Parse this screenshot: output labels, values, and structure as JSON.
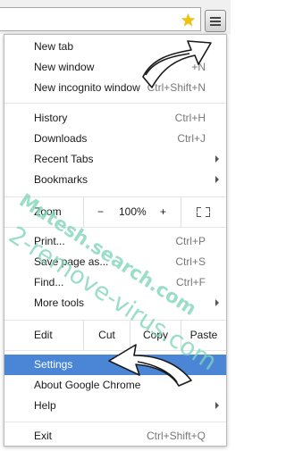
{
  "toolbar": {
    "star_icon": "bookmark-star-icon",
    "menu_icon": "hamburger-menu-icon"
  },
  "menu": {
    "group1": [
      {
        "label": "New tab",
        "shortcut": ""
      },
      {
        "label": "New window",
        "shortcut": "+N"
      },
      {
        "label": "New incognito window",
        "shortcut": "Ctrl+Shift+N"
      }
    ],
    "group2": [
      {
        "label": "History",
        "shortcut": "Ctrl+H",
        "submenu": false
      },
      {
        "label": "Downloads",
        "shortcut": "Ctrl+J",
        "submenu": false
      },
      {
        "label": "Recent Tabs",
        "shortcut": "",
        "submenu": true
      },
      {
        "label": "Bookmarks",
        "shortcut": "",
        "submenu": true
      }
    ],
    "zoom": {
      "label": "Zoom",
      "minus": "−",
      "value": "100%",
      "plus": "+"
    },
    "group3": [
      {
        "label": "Print...",
        "shortcut": "Ctrl+P",
        "submenu": false
      },
      {
        "label": "Save page as...",
        "shortcut": "Ctrl+S",
        "submenu": false
      },
      {
        "label": "Find...",
        "shortcut": "Ctrl+F",
        "submenu": false
      },
      {
        "label": "More tools",
        "shortcut": "",
        "submenu": true
      }
    ],
    "edit": {
      "label": "Edit",
      "cut": "Cut",
      "copy": "Copy",
      "paste": "Paste"
    },
    "group4": [
      {
        "label": "Settings",
        "shortcut": "",
        "submenu": false,
        "selected": true
      },
      {
        "label": "About Google Chrome",
        "shortcut": "",
        "submenu": false
      },
      {
        "label": "Help",
        "shortcut": "",
        "submenu": true
      }
    ],
    "exit": {
      "label": "Exit",
      "shortcut": "Ctrl+Shift+Q"
    }
  },
  "watermark": {
    "line1": "Mutesh.search.com",
    "line2": "2-remove-virus.com"
  },
  "colors": {
    "selected": "#4b86d6",
    "watermark": "#7fd6b8"
  }
}
